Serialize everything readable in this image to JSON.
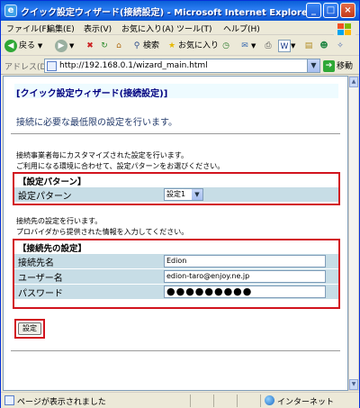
{
  "window": {
    "title": "クイック設定ウィザード(接続設定) - Microsoft Internet Explorer",
    "minimize": "_",
    "maximize": "□",
    "close": "×"
  },
  "menu": {
    "items": [
      "ファイル(F)",
      "編集(E)",
      "表示(V)",
      "お気に入り(A)",
      "ツール(T)",
      "ヘルプ(H)"
    ]
  },
  "toolbar": {
    "back": "戻る",
    "search": "検索",
    "favorites": "お気に入り"
  },
  "address": {
    "label": "アドレス(D)",
    "url": "http://192.168.0.1/wizard_main.html",
    "go": "移動"
  },
  "page": {
    "heading": "[クイック設定ウィザード(接続設定)]",
    "subtitle": "接続に必要な最低限の設定を行います。",
    "note1_line1": "接続事業者毎にカスタマイズされた設定を行います。",
    "note1_line2": "ご利用になる環境に合わせて、設定パターンをお選びください。",
    "section1": {
      "title": "【設定パターン】",
      "pattern_label": "設定パターン",
      "pattern_value": "設定1"
    },
    "note2_line1": "接続先の設定を行います。",
    "note2_line2": "プロバイダから提供された情報を入力してください。",
    "section2": {
      "title": "【接続先の設定】",
      "conn_name_label": "接続先名",
      "conn_name_value": "Edion",
      "username_label": "ユーザー名",
      "username_value": "edion-taro@enjoy.ne.jp",
      "password_label": "パスワード",
      "password_value": "●●●●●●●●●"
    },
    "submit": "設定"
  },
  "status": {
    "text": "ページが表示されました",
    "zone": "インターネット"
  },
  "colors": {
    "title_bar": "#0a5fd8",
    "section_border": "#d2141e",
    "row_bg": "#c7dde6",
    "heading_text": "#000080"
  }
}
